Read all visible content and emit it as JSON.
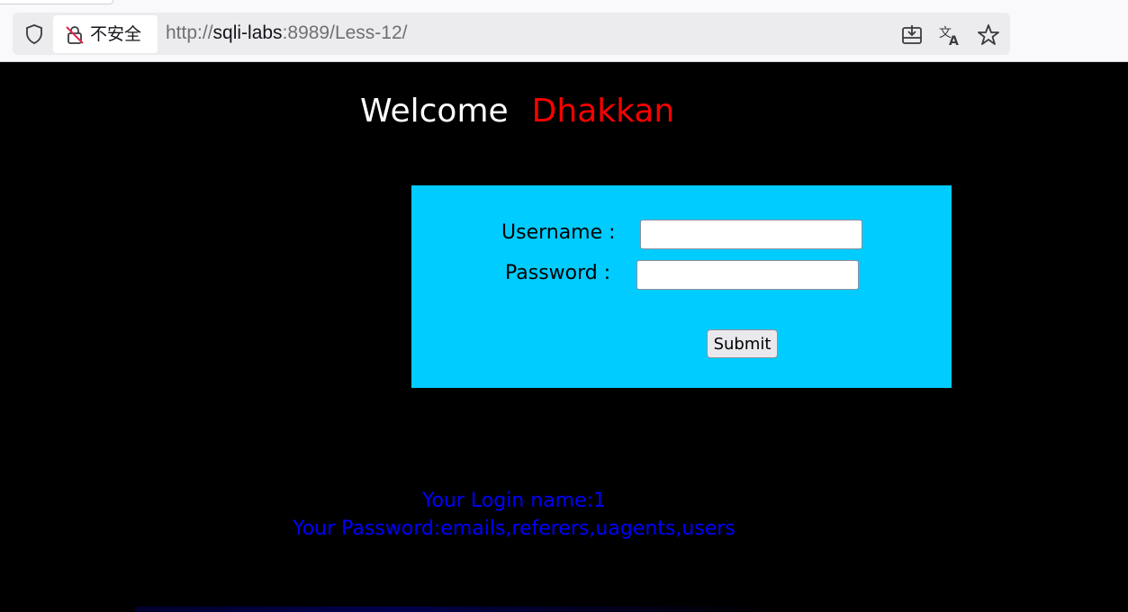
{
  "browser": {
    "security_label": "不安全",
    "url_scheme": "http://",
    "url_host": "sqli-labs",
    "url_rest": ":8989/Less-12/",
    "icons": [
      "shield-icon",
      "insecure-lock-icon",
      "save-page-icon",
      "translate-icon",
      "bookmark-star-icon"
    ]
  },
  "header": {
    "welcome": "Welcome",
    "name": "Dhakkan"
  },
  "login_form": {
    "username_label": "Username :",
    "username_value": "",
    "password_label": "Password :",
    "password_value": "",
    "submit_label": "Submit"
  },
  "result": {
    "login_name": "Your Login name:1",
    "password": "Your Password:emails,referers,uagents,users"
  },
  "colors": {
    "page_bg": "#000000",
    "welcome": "#ffffff",
    "name": "#ff0000",
    "form_bg": "#00ccff",
    "result_text": "#0000ff"
  }
}
